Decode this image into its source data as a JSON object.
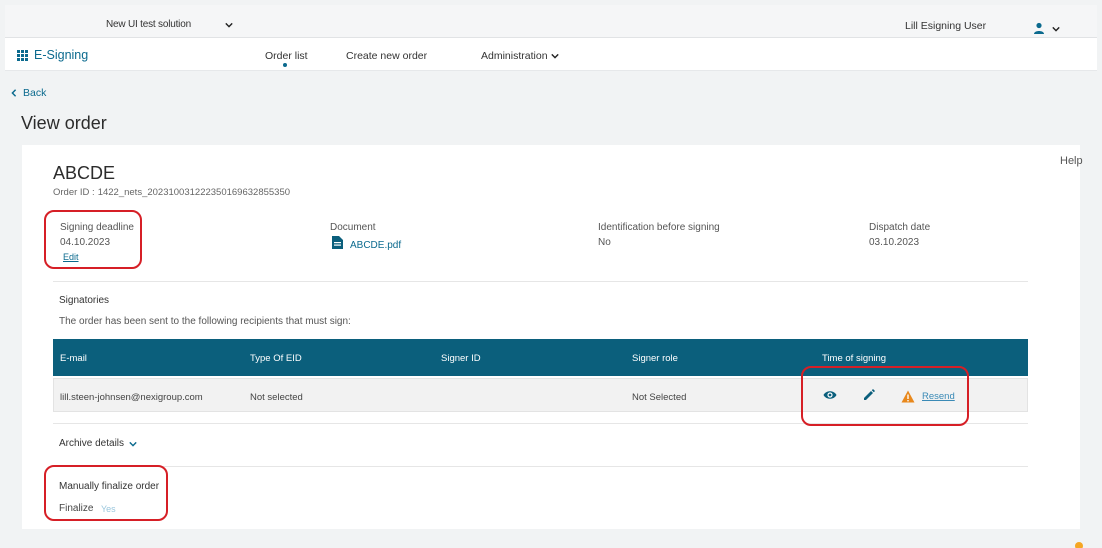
{
  "topbar": {
    "solution": "New UI test solution",
    "user_name": "Lill Esigning User"
  },
  "navbar": {
    "brand": "E-Signing",
    "items": [
      "Order list",
      "Create new order",
      "Administration"
    ]
  },
  "back_label": "Back",
  "page_title": "View order",
  "help_label": "Help",
  "order": {
    "title": "ABCDE",
    "id_label": "Order ID :",
    "id_value": "1422_nets_202310031222350169632855350"
  },
  "info": {
    "signing_deadline_label": "Signing deadline",
    "signing_deadline_value": "04.10.2023",
    "edit_label": "Edit",
    "document_label": "Document",
    "document_value": "ABCDE.pdf",
    "identification_label": "Identification before signing",
    "identification_value": "No",
    "dispatch_label": "Dispatch date",
    "dispatch_value": "03.10.2023"
  },
  "signatories": {
    "title": "Signatories",
    "description": "The order has been sent to the following recipients that must sign:",
    "headers": [
      "E-mail",
      "Type Of EID",
      "Signer ID",
      "Signer role",
      "Time of signing"
    ],
    "rows": [
      {
        "email": "lill.steen-johnsen@nexigroup.com",
        "eid": "Not selected",
        "signer_id": "",
        "role": "Not Selected",
        "action": "Resend",
        "icons": [
          "eye-icon",
          "pencil-icon",
          "warning-icon"
        ]
      }
    ]
  },
  "archive_label": "Archive details",
  "finalize": {
    "title": "Manually finalize order",
    "label": "Finalize",
    "value": "Yes"
  },
  "colors": {
    "brand": "#0b6a8e",
    "table_header": "#0b5f7c",
    "warning": "#e8881c",
    "highlight": "#d61f26"
  }
}
